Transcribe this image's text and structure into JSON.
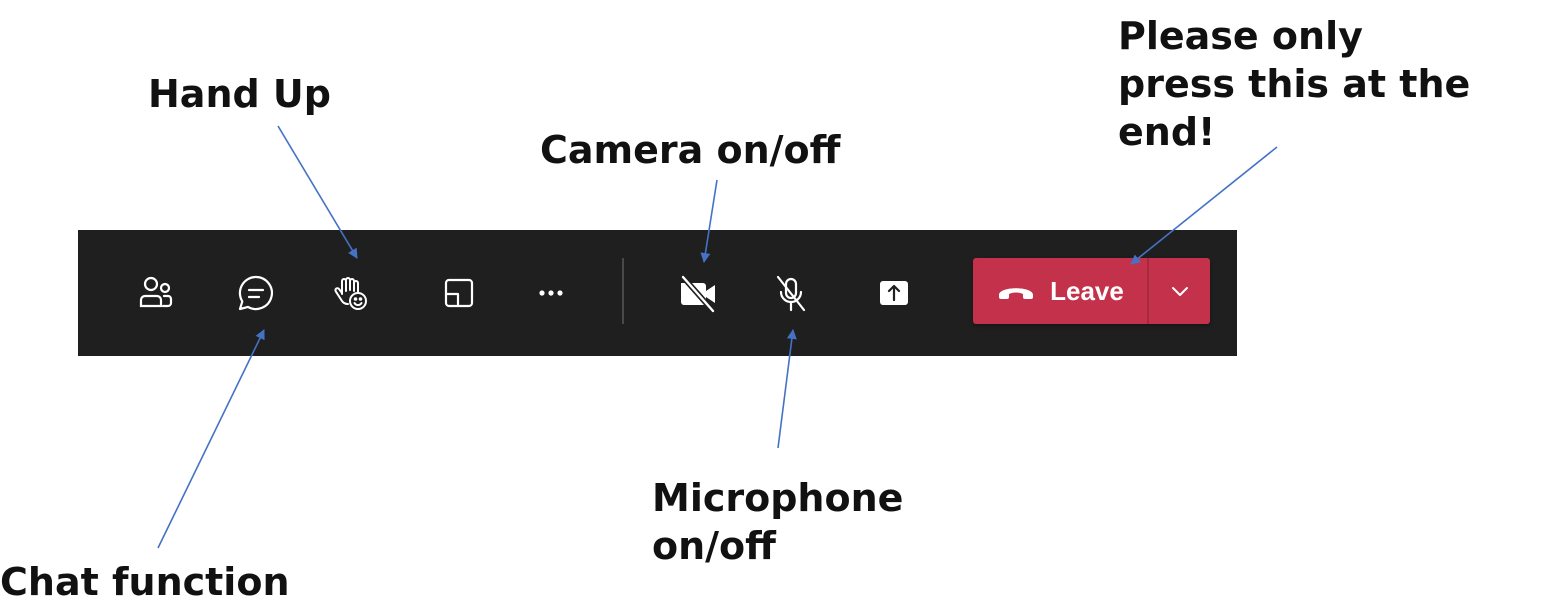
{
  "annotations": {
    "hand_up": "Hand Up",
    "camera": "Camera on/off",
    "leave_note_line1": "Please only",
    "leave_note_line2": "press this at the",
    "leave_note_line3": "end!",
    "microphone_line1": "Microphone",
    "microphone_line2": "on/off",
    "chat": "Chat function"
  },
  "toolbar": {
    "background": "#201f1f",
    "buttons": [
      {
        "icon": "people-icon"
      },
      {
        "icon": "chat-icon"
      },
      {
        "icon": "raise-hand-reaction-icon"
      },
      {
        "icon": "rooms-icon"
      },
      {
        "icon": "more-options-icon"
      },
      {
        "icon": "camera-off-icon"
      },
      {
        "icon": "microphone-off-icon"
      },
      {
        "icon": "share-tray-icon"
      }
    ],
    "leave": {
      "label": "Leave",
      "color": "#c4314b",
      "icon": "phone-hangup-icon",
      "menu_icon": "chevron-down-icon"
    }
  },
  "colors": {
    "arrow": "#4472c4",
    "annotation_text": "#111111",
    "icon": "#ffffff"
  }
}
